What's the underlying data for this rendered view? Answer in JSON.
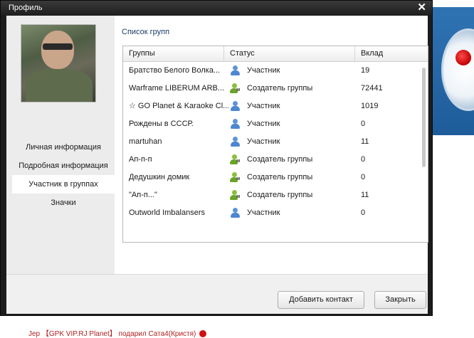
{
  "window": {
    "title": "Профиль"
  },
  "sidebar": {
    "items": [
      {
        "label": "Личная информация",
        "active": false
      },
      {
        "label": "Подробная информация",
        "active": false
      },
      {
        "label": "Участник в группах",
        "active": true
      },
      {
        "label": "Значки",
        "active": false
      }
    ]
  },
  "main": {
    "section_title": "Список групп",
    "columns": [
      "Группы",
      "Статус",
      "Вклад"
    ],
    "rows": [
      {
        "name": "Братство Белого Волка...",
        "status": "Участник",
        "status_icon": "user-icon",
        "contrib": "19"
      },
      {
        "name": "Warframe LIBERUM ARB...",
        "status": "Создатель группы",
        "status_icon": "creator-icon",
        "contrib": "72441"
      },
      {
        "name": "☆ GO Planet & Karaoke Cl...",
        "status": "Участник",
        "status_icon": "user-icon",
        "contrib": "1019"
      },
      {
        "name": "Рождены в СССР.",
        "status": "Участник",
        "status_icon": "user-icon",
        "contrib": "0"
      },
      {
        "name": "martuhan",
        "status": "Участник",
        "status_icon": "user-icon",
        "contrib": "11"
      },
      {
        "name": "Ап-п-п",
        "status": "Создатель группы",
        "status_icon": "creator-icon",
        "contrib": "0"
      },
      {
        "name": "Дедушкин домик",
        "status": "Создатель группы",
        "status_icon": "creator-icon",
        "contrib": "0"
      },
      {
        "name": "\"Ап-п...\"",
        "status": "Создатель группы",
        "status_icon": "creator-icon",
        "contrib": "11"
      },
      {
        "name": "Outworld Imbalansers",
        "status": "Участник",
        "status_icon": "user-icon",
        "contrib": "0"
      }
    ]
  },
  "footer": {
    "add_contact": "Добавить контакт",
    "close": "Закрыть"
  },
  "background": {
    "line2_prefix": "Jep",
    "line2_tag": "【GPK VIP.RJ Planet】",
    "line2_text": "подарил",
    "line2_target": "Сата4(Кристя)"
  },
  "colors": {
    "accent_title": "#1b3d6b",
    "member_icon": "#4e86cf",
    "creator_icon": "#6aa326"
  }
}
